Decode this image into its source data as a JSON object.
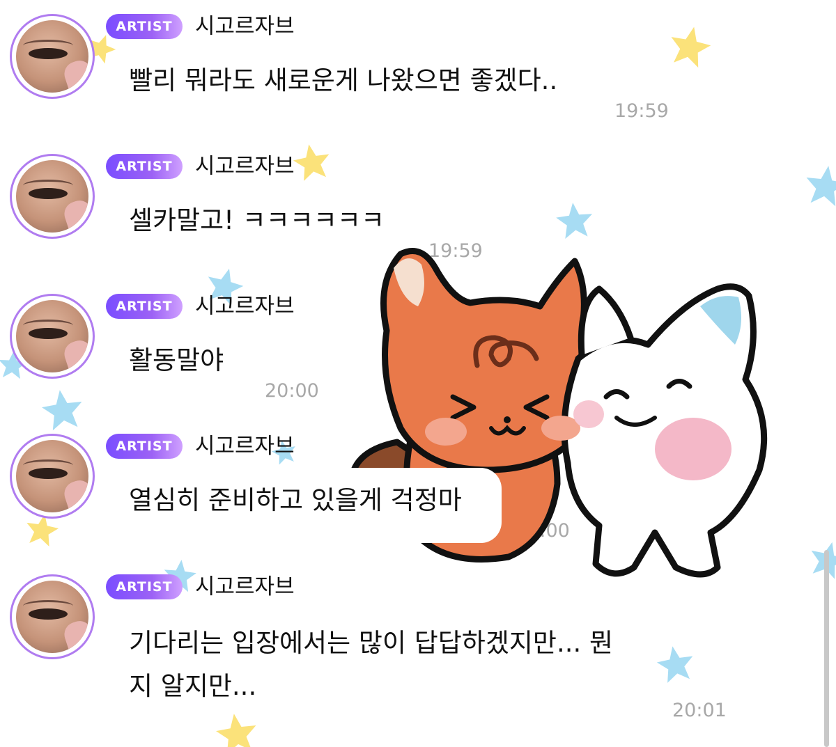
{
  "chat": {
    "messages": [
      {
        "badge": "ARTIST",
        "sender": "시고르자브",
        "lines": [
          "빨리 뭐라도 새로운게 나왔으면 좋겠다.."
        ],
        "time": "19:59"
      },
      {
        "badge": "ARTIST",
        "sender": "시고르자브",
        "lines": [
          "셀카말고! ㅋㅋㅋㅋㅋㅋ"
        ],
        "time": "19:59"
      },
      {
        "badge": "ARTIST",
        "sender": "시고르자브",
        "lines": [
          "활동말야"
        ],
        "time": "20:00"
      },
      {
        "badge": "ARTIST",
        "sender": "시고르자브",
        "lines": [
          "열심히 준비하고 있을게 걱정마"
        ],
        "time": "20:00"
      },
      {
        "badge": "ARTIST",
        "sender": "시고르자브",
        "lines": [
          "기다리는 입장에서는 많이 답답하겠지만... 뭔",
          "지 알지만..."
        ],
        "time": "20:01"
      }
    ]
  },
  "sticker": {
    "name": "fox-and-white-dog-sticker"
  },
  "colors": {
    "badge_gradient_start": "#7a4dff",
    "badge_gradient_end": "#cfa0ff",
    "avatar_ring": "#b07cf0",
    "time_text": "#a8a8a8",
    "star_yellow": "#fbe27a",
    "star_blue": "#a7dcf3",
    "fox_orange": "#e9794a",
    "dog_ear_blue": "#9fd6ec"
  }
}
